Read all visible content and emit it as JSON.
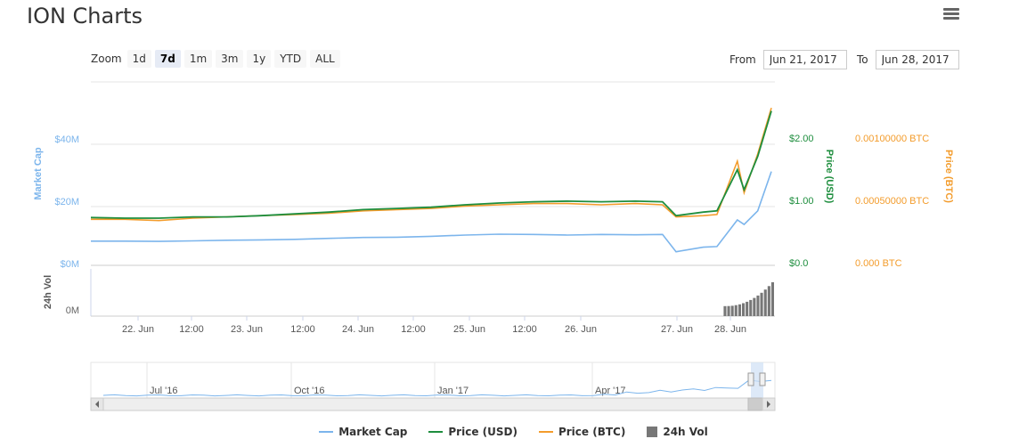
{
  "title": "ION Charts",
  "zoom": {
    "label": "Zoom",
    "buttons": [
      "1d",
      "7d",
      "1m",
      "3m",
      "1y",
      "YTD",
      "ALL"
    ],
    "active": "7d"
  },
  "range": {
    "from_label": "From",
    "from_value": "Jun 21, 2017",
    "to_label": "To",
    "to_value": "Jun 28, 2017"
  },
  "colors": {
    "market_cap": "#7cb5ec",
    "price_usd": "#1e8e3e",
    "price_btc": "#f39c2c",
    "vol": "#777777"
  },
  "chart_data": {
    "type": "line",
    "x_ticks": [
      "22. Jun",
      "12:00",
      "23. Jun",
      "12:00",
      "24. Jun",
      "12:00",
      "25. Jun",
      "12:00",
      "26. Jun",
      "27. Jun",
      "28. Jun"
    ],
    "axes": {
      "market_cap": {
        "label": "Market Cap",
        "ticks": [
          "$0M",
          "$20M",
          "$40M"
        ],
        "range": [
          0,
          40
        ]
      },
      "price_usd": {
        "label": "Price (USD)",
        "ticks": [
          "$0.0",
          "$1.00",
          "$2.00"
        ],
        "range": [
          0,
          2
        ]
      },
      "price_btc": {
        "label": "Price (BTC)",
        "ticks": [
          "0.000 BTC",
          "0.00050000 BTC",
          "0.00100000 BTC"
        ],
        "range": [
          0,
          0.001
        ]
      },
      "volume": {
        "label": "24h Vol",
        "ticks": [
          "0M"
        ]
      }
    },
    "x": [
      0,
      0.05,
      0.1,
      0.15,
      0.2,
      0.25,
      0.3,
      0.35,
      0.4,
      0.45,
      0.5,
      0.55,
      0.6,
      0.65,
      0.7,
      0.75,
      0.8,
      0.84,
      0.86,
      0.9,
      0.92,
      0.95,
      0.96,
      0.98,
      1.0
    ],
    "series": [
      {
        "name": "Market Cap",
        "axis": "market_cap",
        "values": [
          8.0,
          8.0,
          7.9,
          8.1,
          8.3,
          8.4,
          8.6,
          8.9,
          9.2,
          9.3,
          9.6,
          10.0,
          10.3,
          10.2,
          10.0,
          10.2,
          10.1,
          10.2,
          4.5,
          6.0,
          6.2,
          15.0,
          13.5,
          18.0,
          31.0
        ]
      },
      {
        "name": "Price (USD)",
        "axis": "price_usd",
        "values": [
          0.79,
          0.78,
          0.78,
          0.8,
          0.8,
          0.82,
          0.85,
          0.88,
          0.92,
          0.94,
          0.96,
          1.0,
          1.03,
          1.05,
          1.06,
          1.05,
          1.06,
          1.05,
          0.82,
          0.88,
          0.9,
          1.58,
          1.25,
          1.8,
          2.55
        ]
      },
      {
        "name": "Price (BTC)",
        "axis": "price_btc",
        "values": [
          0.00038,
          0.00038,
          0.00037,
          0.00039,
          0.0004,
          0.00041,
          0.00042,
          0.00043,
          0.00045,
          0.00046,
          0.00047,
          0.00049,
          0.0005,
          0.00051,
          0.00051,
          0.0005,
          0.00051,
          0.0005,
          0.0004,
          0.00041,
          0.00042,
          0.00086,
          0.0006,
          0.00092,
          0.0013
        ]
      }
    ],
    "volume": {
      "name": "24h Vol",
      "x_start": 0.925,
      "count": 14,
      "start_fraction": 0.28,
      "end_fraction": 0.95
    },
    "navigator_ticks": [
      "Jul '16",
      "Oct '16",
      "Jan '17",
      "Apr '17"
    ],
    "legend": [
      "Market Cap",
      "Price (USD)",
      "Price (BTC)",
      "24h Vol"
    ],
    "legend_placement": "bottom-center",
    "grid": true
  }
}
